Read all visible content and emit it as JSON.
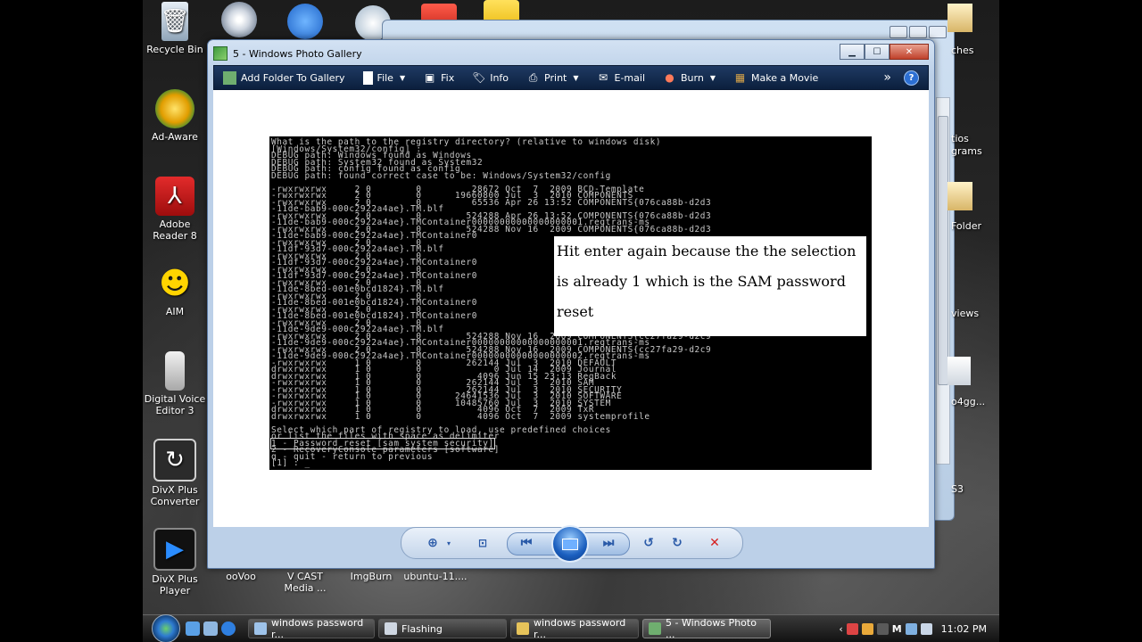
{
  "desktop": {
    "icons": [
      {
        "label": "Recycle Bin"
      },
      {
        "label": "Ad-Aware"
      },
      {
        "label": "Adobe Reader 8"
      },
      {
        "label": "AIM"
      },
      {
        "label": "Digital Voice Editor 3"
      },
      {
        "label": "DivX Plus Converter"
      },
      {
        "label": "DivX Plus Player"
      }
    ],
    "bottom_icons": [
      {
        "label": "ooVoo"
      },
      {
        "label": "V CAST Media ..."
      },
      {
        "label": "ImgBurn"
      },
      {
        "label": "ubuntu-11...."
      }
    ],
    "right_labels": [
      "ches",
      "tios",
      "grams",
      "Folder",
      "views",
      "o4gg...",
      "S3"
    ]
  },
  "window": {
    "title": "5 - Windows Photo Gallery",
    "toolbar": {
      "add_folder": "Add Folder To Gallery",
      "file": "File",
      "fix": "Fix",
      "info": "Info",
      "print": "Print",
      "email": "E-mail",
      "burn": "Burn",
      "make_movie": "Make a Movie",
      "more": "»",
      "help": "?"
    }
  },
  "console": {
    "lines": [
      "What is the path to the registry directory? (relative to windows disk)",
      "[Windows/System32/config] :",
      "DEBUG path: Windows found as Windows",
      "DEBUG path: System32 found as System32",
      "DEBUG path: config found as config",
      "DEBUG path: found correct case to be: Windows/System32/config",
      "",
      "-rwxrwxrwx     2 0        0         28672 Oct  7  2009 BCD-Template",
      "-rwxrwxrwx     2 0        0      19660800 Jul  3  2010 COMPONENTS",
      "-rwxrwxrwx     2 0        0         65536 Apr 26 13:52 COMPONENTS{076ca88b-d2d3",
      "-11de-bab9-000c2922a4ae}.TM.blf",
      "-rwxrwxrwx     2 0        0        524288 Apr 26 13:52 COMPONENTS{076ca88b-d2d3",
      "-11de-bab9-000c2922a4ae}.TMContainer00000000000000000001.regtrans-ms",
      "-rwxrwxrwx     2 0        0        524288 Nov 16  2009 COMPONENTS{076ca88b-d2d3",
      "-11de-bab9-000c2922a4ae}.TMContainer0",
      "-rwxrwxrwx     2 0        0",
      "-11df-93d7-000c2922a4ae}.TM.blf",
      "-rwxrwxrwx     2 0        0",
      "-11df-93d7-000c2922a4ae}.TMContainer0",
      "-rwxrwxrwx     2 0        0",
      "-11df-93d7-000c2922a4ae}.TMContainer0",
      "-rwxrwxrwx     2 0        0",
      "-11de-8bed-001e0bcd1824}.TM.blf",
      "-rwxrwxrwx     2 0        0",
      "-11de-8bed-001e0bcd1824}.TMContainer0",
      "-rwxrwxrwx     2 0        0",
      "-11de-8bed-001e0bcd1824}.TMContainer0",
      "-rwxrwxrwx     2 0        0",
      "-11de-9de9-000c2922a4ae}.TM.blf",
      "-rwxrwxrwx     2 0        0        524288 Nov 16  2009 COMPONENTS{cc27fa29-d2c9",
      "-11de-9de9-000c2922a4ae}.TMContainer00000000000000000001.regtrans-ms",
      "-rwxrwxrwx     2 0        0        524288 Nov 16  2009 COMPONENTS{cc27fa29-d2c9",
      "-11de-9de9-000c2922a4ae}.TMContainer00000000000000000002.regtrans-ms",
      "-rwxrwxrwx     1 0        0        262144 Jul  3  2010 DEFAULT",
      "drwxrwxrwx     1 0        0             0 Jul 14  2009 Journal",
      "drwxrwxrwx     1 0        0          4096 Jun 15 23:13 RegBack",
      "-rwxrwxrwx     1 0        0        262144 Jul  3  2010 SAM",
      "-rwxrwxrwx     1 0        0        262144 Jul  3  2010 SECURITY",
      "-rwxrwxrwx     1 0        0      24641536 Jul  3  2010 SOFTWARE",
      "-rwxrwxrwx     1 0        0      10485760 Jul  3  2010 SYSTEM",
      "drwxrwxrwx     1 0        0          4096 Oct  7  2009 TxR",
      "drwxrwxrwx     1 0        0          4096 Oct  7  2009 systemprofile",
      "",
      "Select which part of registry to load, use predefined choices",
      "or list the files with space as delimiter",
      "1 - Password reset [sam system security]",
      "2 - RecoveryConsole parameters [software]",
      "q - quit - return to previous",
      "[1] : _"
    ],
    "annotation": "Hit enter again because the the selection is already 1 which is the SAM password reset"
  },
  "controls": {
    "zoom": "zoom-icon",
    "actual_size": "actual-size-icon",
    "previous": "previous-icon",
    "slideshow": "slideshow-icon",
    "next": "next-icon",
    "rotate_ccw": "rotate-counterclockwise-icon",
    "rotate_cw": "rotate-clockwise-icon",
    "delete": "delete-icon"
  },
  "taskbar": {
    "tasks": [
      {
        "label": "windows password r..."
      },
      {
        "label": "Flashing"
      },
      {
        "label": "windows password r..."
      },
      {
        "label": "5 - Windows Photo ..."
      }
    ],
    "tray": {
      "lang": "M",
      "time": "11:02 PM"
    }
  }
}
